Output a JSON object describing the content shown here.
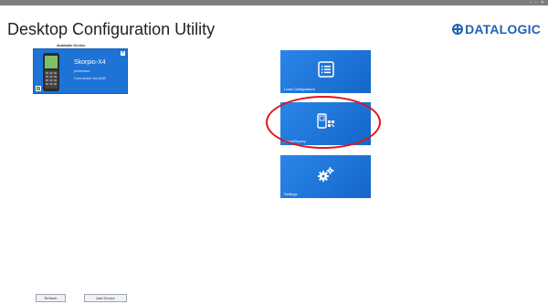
{
  "window": {
    "controls": [
      "–",
      "▫",
      "✕"
    ]
  },
  "app": {
    "title": "Desktop Configuration Utility",
    "logo_text": "DATALOGIC",
    "brand_color": "#1f63b5"
  },
  "device_panel": {
    "caption": "Available Device",
    "name": "Skorpio-X4",
    "sub_label": "prkfctraxe",
    "connection": "Connected via ADB"
  },
  "tiles": [
    {
      "label": "Load Configuration",
      "icon": "list-icon"
    },
    {
      "label": "Scan2Deploy",
      "icon": "scanner-barcode-icon"
    },
    {
      "label": "Settings",
      "icon": "gears-icon"
    }
  ],
  "footer": {
    "refresh_label": "Refresh",
    "add_device_label": "Add Device"
  },
  "colors": {
    "tile": "#1e73d6",
    "highlight": "#e0141a"
  }
}
